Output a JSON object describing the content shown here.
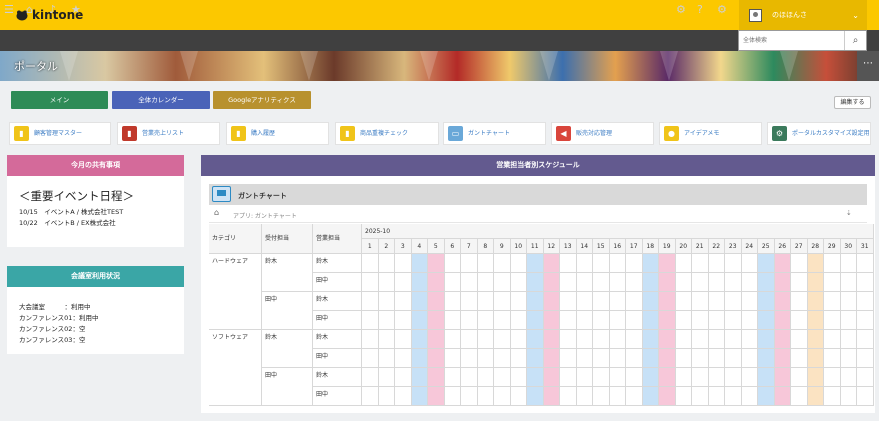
{
  "app": {
    "logo": "kintone",
    "username": "のほほんさ"
  },
  "search": {
    "placeholder": "全体検索"
  },
  "banner": {
    "title": "ポータル"
  },
  "tabs": [
    {
      "label": "メイン",
      "color": "#2e8b57"
    },
    {
      "label": "全体カレンダー",
      "color": "#4a63b8"
    },
    {
      "label": "Googleアナリティクス",
      "color": "#b8912e"
    }
  ],
  "edit_label": "編集する",
  "apps": [
    {
      "label": "顧客管理マスター",
      "icon": "folder-icon",
      "color": "#f0c419"
    },
    {
      "label": "営業売上リスト",
      "icon": "book-icon",
      "color": "#c0392b"
    },
    {
      "label": "購入履歴",
      "icon": "clipboard-icon",
      "color": "#f0c419"
    },
    {
      "label": "商品重複チェック",
      "icon": "document-icon",
      "color": "#f0c419"
    },
    {
      "label": "ガントチャート",
      "icon": "monitor-icon",
      "color": "#6aa8d8"
    },
    {
      "label": "販売対応管理",
      "icon": "megaphone-icon",
      "color": "#d9453b"
    },
    {
      "label": "アイデアメモ",
      "icon": "lightbulb-icon",
      "color": "#f0c419"
    },
    {
      "label": "ポータルカスタマイズ設定用",
      "icon": "gear-icon",
      "color": "#3b7a5c"
    }
  ],
  "notice": {
    "title": "今月の共有事項",
    "color": "#d46a9a",
    "heading": "＜重要イベント日程＞",
    "lines": [
      "10/15　イベントA / 株式会社TEST",
      "10/22　イベントB / EX株式会社"
    ]
  },
  "conference": {
    "title": "会議室利用状況",
    "color": "#3aa6a6",
    "lines": [
      "大会議室　　　：利用中",
      "カンファレンス01：利用中",
      "カンファレンス02：空",
      "カンファレンス03：空"
    ]
  },
  "schedule": {
    "title": "営業担当者別スケジュール",
    "color": "#635a8f",
    "gantt_title": "ガントチャート",
    "crumb": "アプリ: ガントチャート",
    "month": "2025-10",
    "headers": [
      "カテゴリ",
      "受付担当",
      "営業担当"
    ],
    "days": [
      "1",
      "2",
      "3",
      "4",
      "5",
      "6",
      "7",
      "8",
      "9",
      "10",
      "11",
      "12",
      "13",
      "14",
      "15",
      "16",
      "17",
      "18",
      "19",
      "20",
      "21",
      "22",
      "23",
      "24",
      "25",
      "26",
      "27",
      "28",
      "29",
      "30",
      "31"
    ],
    "saturdays": [
      4,
      11,
      18,
      25
    ],
    "sundays": [
      5,
      12,
      19,
      26
    ],
    "highlight_day": 28,
    "colors": {
      "saturday": "#c7e1f7",
      "sunday": "#f7c7d9",
      "highlight": "#fbe3c2"
    },
    "rows": [
      {
        "category": "ハードウェア",
        "reception": "鈴木",
        "sales": "鈴木"
      },
      {
        "category": "",
        "reception": "",
        "sales": "田中"
      },
      {
        "category": "",
        "reception": "田中",
        "sales": "鈴木"
      },
      {
        "category": "",
        "reception": "",
        "sales": "田中"
      },
      {
        "category": "ソフトウェア",
        "reception": "鈴木",
        "sales": "鈴木"
      },
      {
        "category": "",
        "reception": "",
        "sales": "田中"
      },
      {
        "category": "",
        "reception": "田中",
        "sales": "鈴木"
      },
      {
        "category": "",
        "reception": "",
        "sales": "田中"
      }
    ]
  }
}
